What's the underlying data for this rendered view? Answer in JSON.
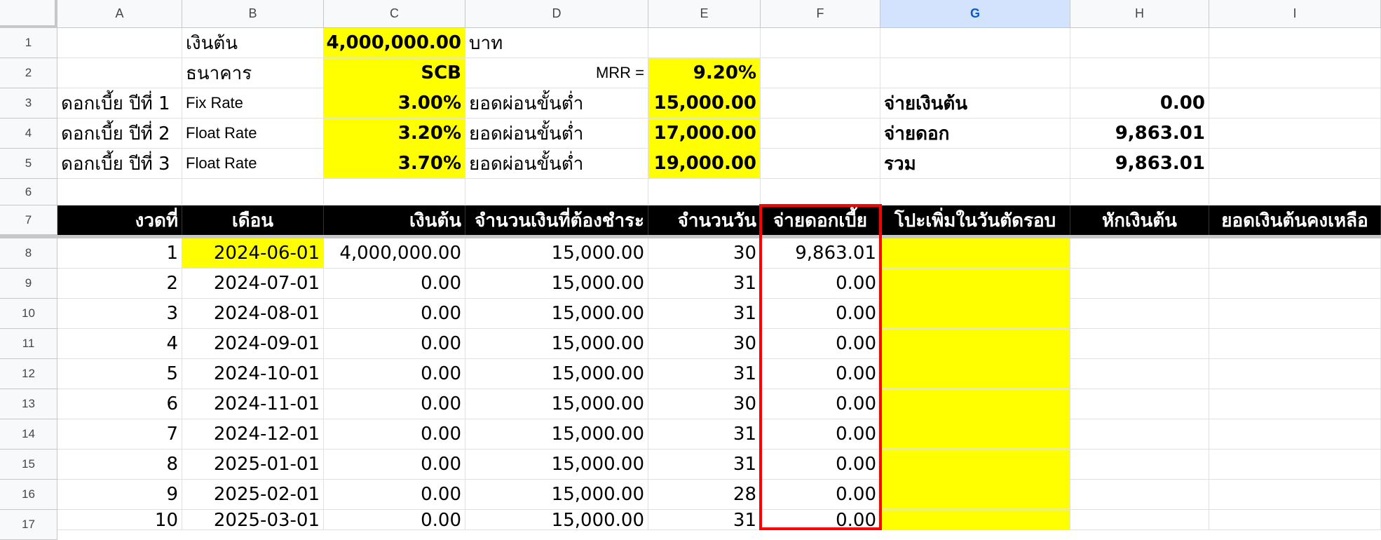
{
  "columns": [
    "A",
    "B",
    "C",
    "D",
    "E",
    "F",
    "G",
    "H",
    "I"
  ],
  "selected_column": "G",
  "rows": [
    "1",
    "2",
    "3",
    "4",
    "5",
    "6",
    "7",
    "8",
    "9",
    "10",
    "11",
    "12",
    "13",
    "14",
    "15",
    "16",
    "17"
  ],
  "summary": {
    "principal_label": "เงินต้น",
    "principal_value": "4,000,000.00",
    "currency": "บาท",
    "bank_label": "ธนาคาร",
    "bank_value": "SCB",
    "mrr_label": "MRR =",
    "mrr_value": "9.20%",
    "rates": [
      {
        "year": "ดอกเบี้ย ปีที่ 1",
        "type": "Fix Rate",
        "rate": "3.00%",
        "min_label": "ยอดผ่อนขั้นต่ำ",
        "min_value": "15,000.00"
      },
      {
        "year": "ดอกเบี้ย ปีที่ 2",
        "type": "Float Rate",
        "rate": "3.20%",
        "min_label": "ยอดผ่อนขั้นต่ำ",
        "min_value": "17,000.00"
      },
      {
        "year": "ดอกเบี้ย ปีที่ 3",
        "type": "Float Rate",
        "rate": "3.70%",
        "min_label": "ยอดผ่อนขั้นต่ำ",
        "min_value": "19,000.00"
      }
    ],
    "pay_principal_label": "จ่ายเงินต้น",
    "pay_principal_value": "0.00",
    "pay_interest_label": "จ่ายดอก",
    "pay_interest_value": "9,863.01",
    "total_label": "รวม",
    "total_value": "9,863.01"
  },
  "table": {
    "headers": [
      "งวดที่",
      "เดือน",
      "เงินต้น",
      "จำนวนเงินที่ต้องชำระ",
      "จำนวนวัน",
      "จ่ายดอกเบี้ย",
      "โปะเพิ่มในวันตัดรอบ",
      "หักเงินต้น",
      "ยอดเงินต้นคงเหลือ"
    ],
    "rows": [
      {
        "no": "1",
        "month": "2024-06-01",
        "principal": "4,000,000.00",
        "payment": "15,000.00",
        "days": "30",
        "interest": "9,863.01"
      },
      {
        "no": "2",
        "month": "2024-07-01",
        "principal": "0.00",
        "payment": "15,000.00",
        "days": "31",
        "interest": "0.00"
      },
      {
        "no": "3",
        "month": "2024-08-01",
        "principal": "0.00",
        "payment": "15,000.00",
        "days": "31",
        "interest": "0.00"
      },
      {
        "no": "4",
        "month": "2024-09-01",
        "principal": "0.00",
        "payment": "15,000.00",
        "days": "30",
        "interest": "0.00"
      },
      {
        "no": "5",
        "month": "2024-10-01",
        "principal": "0.00",
        "payment": "15,000.00",
        "days": "31",
        "interest": "0.00"
      },
      {
        "no": "6",
        "month": "2024-11-01",
        "principal": "0.00",
        "payment": "15,000.00",
        "days": "30",
        "interest": "0.00"
      },
      {
        "no": "7",
        "month": "2024-12-01",
        "principal": "0.00",
        "payment": "15,000.00",
        "days": "31",
        "interest": "0.00"
      },
      {
        "no": "8",
        "month": "2025-01-01",
        "principal": "0.00",
        "payment": "15,000.00",
        "days": "31",
        "interest": "0.00"
      },
      {
        "no": "9",
        "month": "2025-02-01",
        "principal": "0.00",
        "payment": "15,000.00",
        "days": "28",
        "interest": "0.00"
      },
      {
        "no": "10",
        "month": "2025-03-01",
        "principal": "0.00",
        "payment": "15,000.00",
        "days": "31",
        "interest": "0.00"
      }
    ]
  },
  "colors": {
    "highlight": "#ffff00",
    "header_bg": "#000000",
    "selection_border": "#ff0000"
  }
}
